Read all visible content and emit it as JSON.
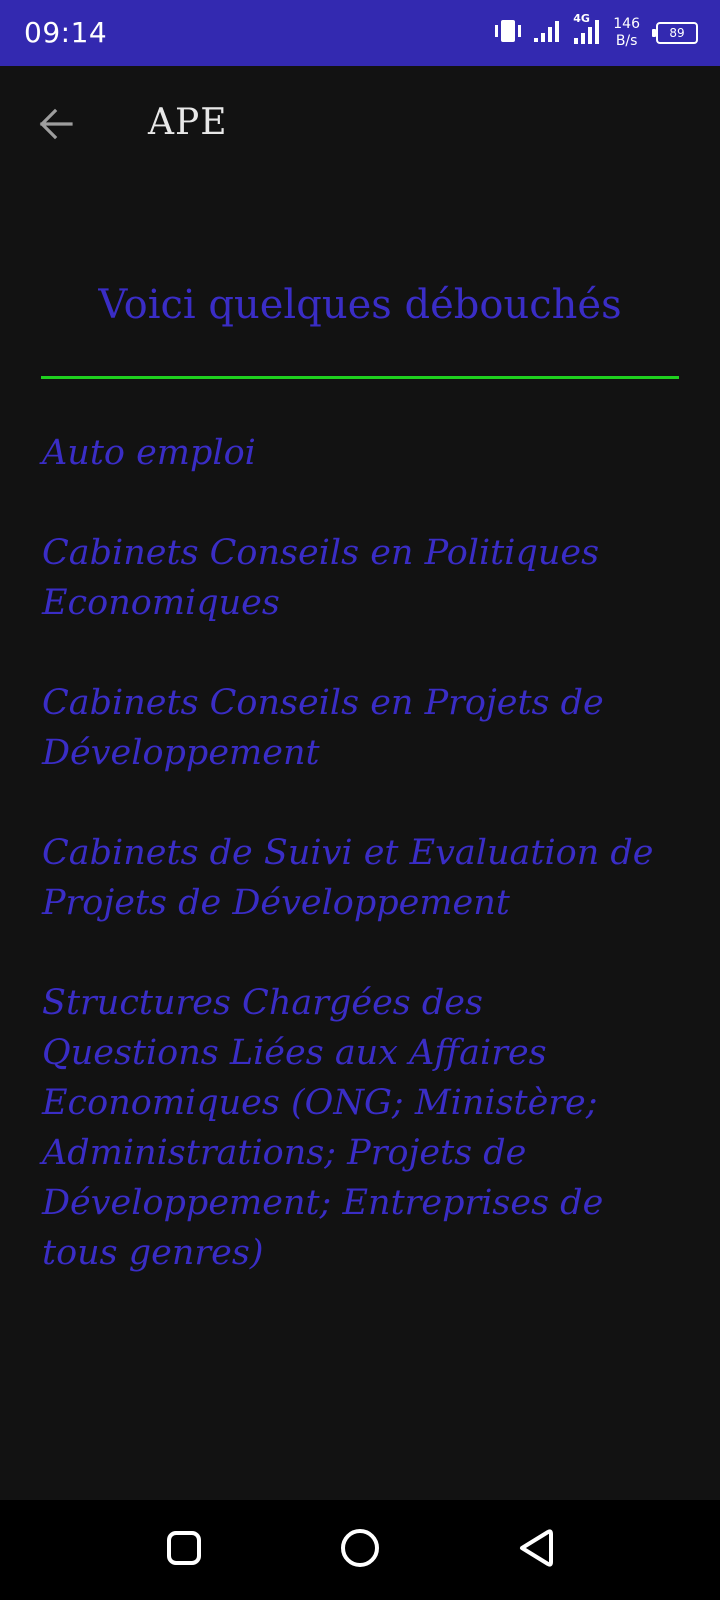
{
  "status_bar": {
    "time": "09:14",
    "net_speed_value": "146",
    "net_speed_unit": "B/s",
    "network_type": "4G",
    "battery_level": "89",
    "icons": [
      "vibrate-icon",
      "signal-icon",
      "signal-4g-icon",
      "battery-icon"
    ]
  },
  "app_bar": {
    "title": "APE",
    "back_icon": "arrow-left-icon"
  },
  "content": {
    "heading": "Voici quelques débouchés",
    "items": [
      {
        "label": "Auto emploi"
      },
      {
        "label": "Cabinets Conseils en Politiques Economiques"
      },
      {
        "label": "Cabinets Conseils en Projets de Développement"
      },
      {
        "label": "Cabinets de Suivi et Evaluation de Projets de Développement"
      },
      {
        "label": "Structures Chargées des Questions Liées aux Affaires Economiques (ONG; Ministère; Administrations; Projets de Développement; Entreprises de tous genres)"
      }
    ]
  },
  "nav_bar": {
    "icons": [
      "square-recents-icon",
      "circle-home-icon",
      "triangle-back-icon"
    ]
  },
  "colors": {
    "status_bar": "#3329b0",
    "background": "#121212",
    "accent_text": "#3a2dc6",
    "divider": "#1fd11f"
  }
}
